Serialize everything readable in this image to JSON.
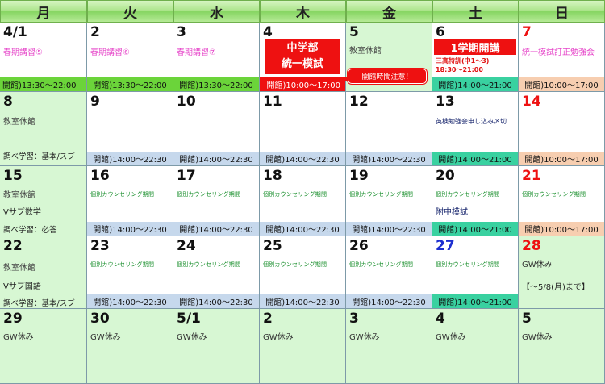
{
  "weekdays": [
    "月",
    "火",
    "水",
    "木",
    "金",
    "土",
    "日"
  ],
  "w1": {
    "c1": {
      "date": "4/1",
      "event": "春期講習⑤",
      "hours": "開館)13:30～22:00"
    },
    "c2": {
      "date": "2",
      "event": "春期講習⑥",
      "hours": "開館)13:30～22:00"
    },
    "c3": {
      "date": "3",
      "event": "春期講習⑦",
      "hours": "開館)13:30～22:00"
    },
    "c4": {
      "date": "4",
      "exam_line1": "中学部",
      "exam_line2": "統一模試",
      "hours": "開館)10:00～17:00"
    },
    "c5": {
      "date": "5",
      "note": "教室休館",
      "callout": "開館時間注意！"
    },
    "c6": {
      "date": "6",
      "title": "1学期開講",
      "sub1": "三高特訓(中1～3)",
      "sub2": "18:30～21:00",
      "hours": "開館)14:00～21:00"
    },
    "c7": {
      "date": "7",
      "event": "統一模試訂正勉強会",
      "hours": "開館)10:00～17:00"
    }
  },
  "w2": {
    "c1": {
      "date": "8",
      "note": "教室休館",
      "study": "調べ学習：基本/スブ"
    },
    "c2": {
      "date": "9",
      "hours": "開館)14:00～22:30"
    },
    "c3": {
      "date": "10",
      "hours": "開館)14:00～22:30"
    },
    "c4": {
      "date": "11",
      "hours": "開館)14:00～22:30"
    },
    "c5": {
      "date": "12",
      "hours": "開館)14:00～22:30"
    },
    "c6": {
      "date": "13",
      "event": "英検勉強会申し込み〆切",
      "hours": "開館)14:00～21:00"
    },
    "c7": {
      "date": "14",
      "hours": "開館)10:00～17:00"
    }
  },
  "w3": {
    "c1": {
      "date": "15",
      "note": "教室休館",
      "sub": "Vサブ数学",
      "study": "調べ学習：必答"
    },
    "c2": {
      "date": "16",
      "counsel": "個別カウンセリング期間",
      "hours": "開館)14:00～22:30"
    },
    "c3": {
      "date": "17",
      "counsel": "個別カウンセリング期間",
      "hours": "開館)14:00～22:30"
    },
    "c4": {
      "date": "18",
      "counsel": "個別カウンセリング期間",
      "hours": "開館)14:00～22:30"
    },
    "c5": {
      "date": "19",
      "counsel": "個別カウンセリング期間",
      "hours": "開館)14:00～22:30"
    },
    "c6": {
      "date": "20",
      "counsel": "個別カウンセリング期間",
      "exam": "附中模試",
      "hours": "開館)14:00～21:00"
    },
    "c7": {
      "date": "21",
      "counsel": "個別カウンセリング期間",
      "hours": "開館)10:00～17:00"
    }
  },
  "w4": {
    "c1": {
      "date": "22",
      "note": "教室休館",
      "sub": "Vサブ国語",
      "study": "調べ学習：基本/スブ"
    },
    "c2": {
      "date": "23",
      "counsel": "個別カウンセリング期間",
      "hours": "開館)14:00～22:30"
    },
    "c3": {
      "date": "24",
      "counsel": "個別カウンセリング期間",
      "hours": "開館)14:00～22:30"
    },
    "c4": {
      "date": "25",
      "counsel": "個別カウンセリング期間",
      "hours": "開館)14:00～22:30"
    },
    "c5": {
      "date": "26",
      "counsel": "個別カウンセリング期間",
      "hours": "開館)14:00～22:30"
    },
    "c6": {
      "date": "27",
      "counsel": "個別カウンセリング期間",
      "hours": "開館)14:00～21:00"
    },
    "c7": {
      "date": "28",
      "gw": "GW休み",
      "gw_range": "【～5/8(月)まで】"
    }
  },
  "w5": {
    "c1": {
      "date": "29",
      "gw": "GW休み"
    },
    "c2": {
      "date": "30",
      "gw": "GW休み"
    },
    "c3": {
      "date": "5/1",
      "gw": "GW休み"
    },
    "c4": {
      "date": "2",
      "gw": "GW休み"
    },
    "c5": {
      "date": "3",
      "gw": "GW休み"
    },
    "c6": {
      "date": "4",
      "gw": "GW休み"
    },
    "c7": {
      "date": "5",
      "gw": "GW休み"
    }
  },
  "colors": {
    "sunday_red": "#ee1111",
    "saturday_blue": "#1d2fd0",
    "holiday_green": "#d7f7d3",
    "header_green": "#86d562"
  }
}
